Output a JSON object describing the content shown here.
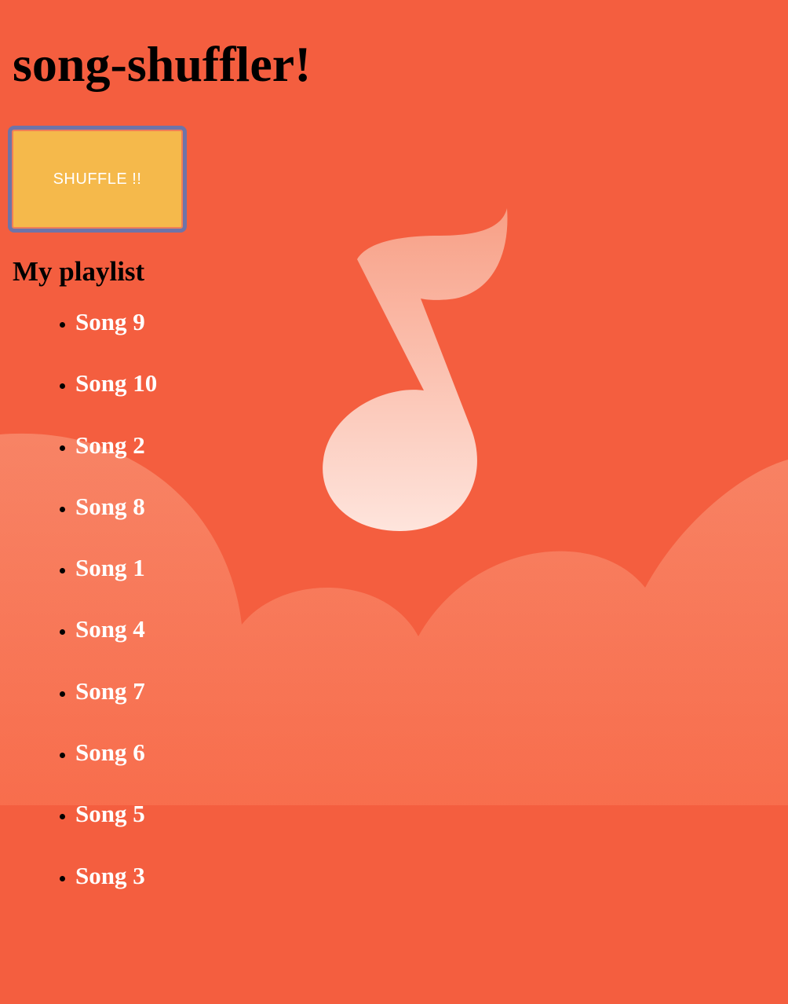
{
  "app": {
    "title": "song-shuffler!"
  },
  "controls": {
    "shuffle_label": "SHUFFLE !!"
  },
  "playlist": {
    "heading": "My playlist",
    "songs": [
      "Song 9",
      "Song 10",
      "Song 2",
      "Song 8",
      "Song 1",
      "Song 4",
      "Song 7",
      "Song 6",
      "Song 5",
      "Song 3"
    ]
  },
  "colors": {
    "background": "#f45e3f",
    "button": "#f5b94b",
    "button_border": "#6e74a8",
    "song_text": "#ffffff"
  },
  "background_art": {
    "icon": "music-note-icon",
    "decoration": "clouds"
  }
}
